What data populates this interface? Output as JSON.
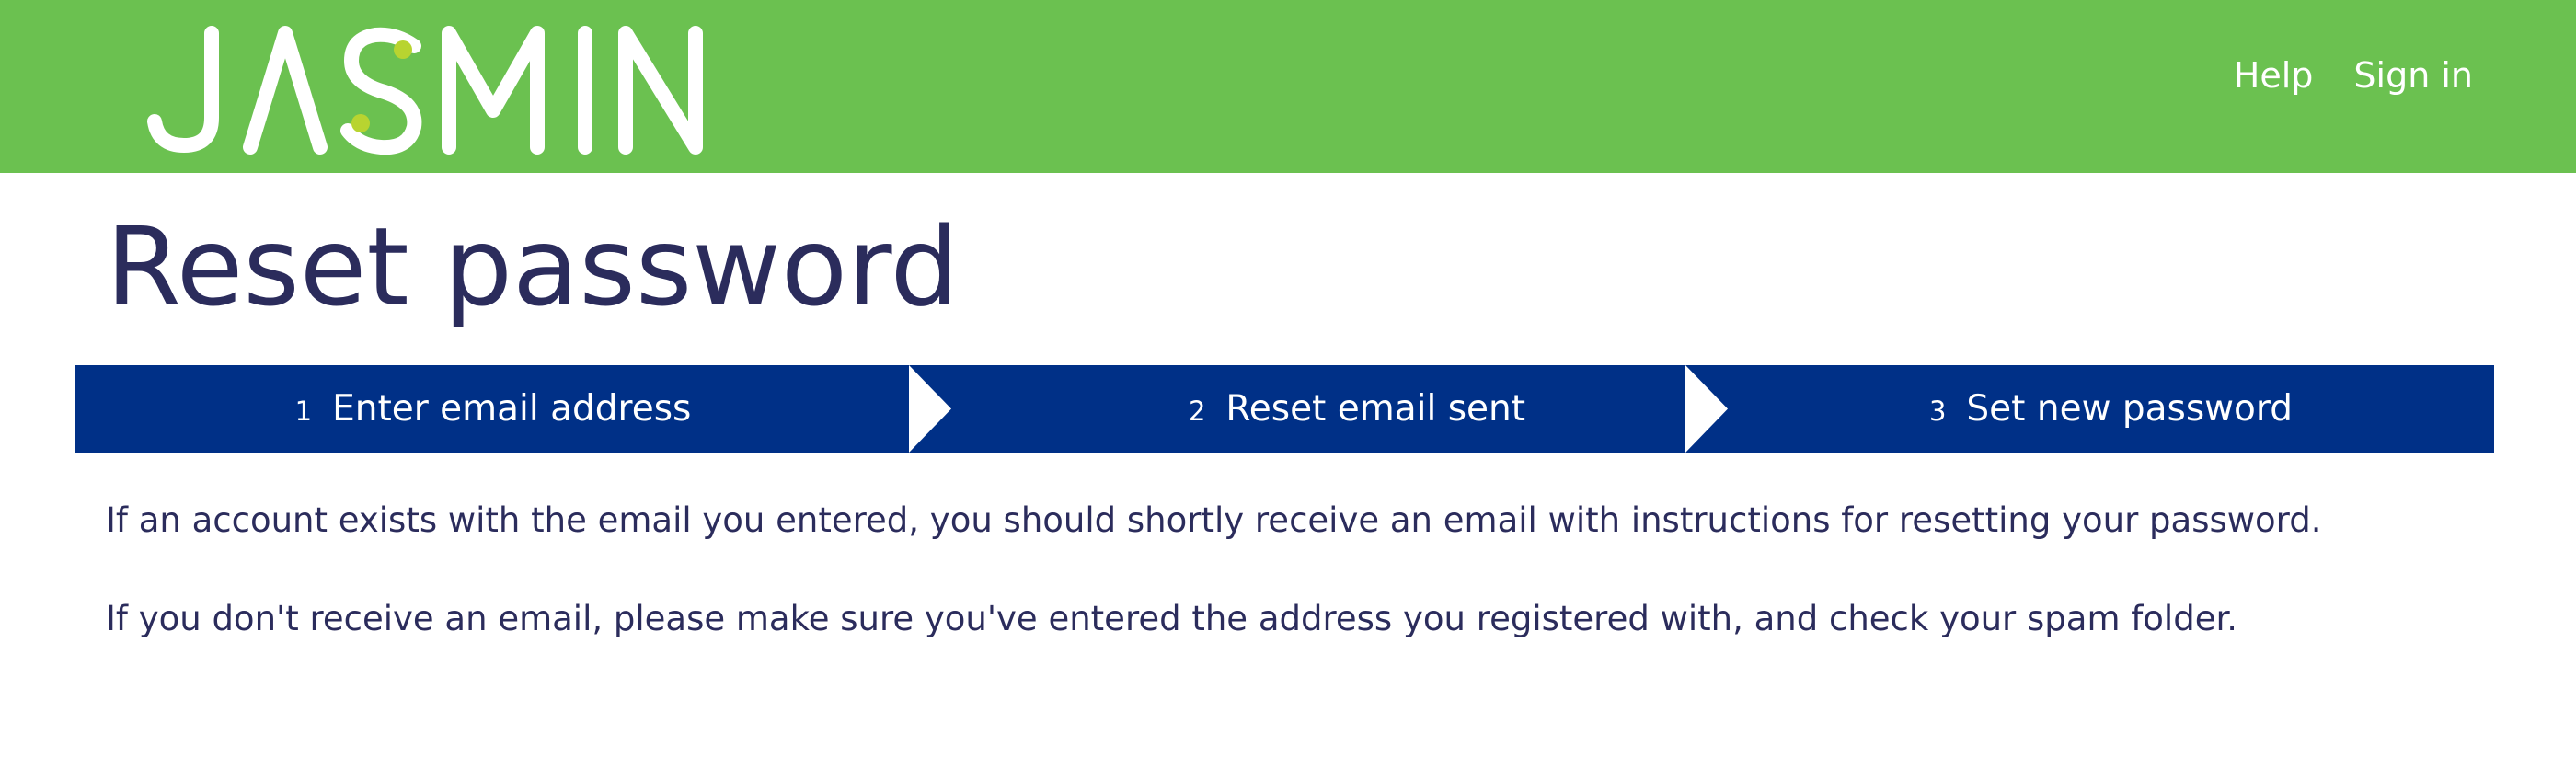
{
  "brand": {
    "logo_text": "JASMIN",
    "header_color": "#6bc150",
    "logo_dot_color": "#b8d430"
  },
  "nav": {
    "help_label": "Help",
    "signin_label": "Sign in"
  },
  "page": {
    "title": "Reset password"
  },
  "steps": [
    {
      "number": "1",
      "label": "Enter email address"
    },
    {
      "number": "2",
      "label": "Reset email sent"
    },
    {
      "number": "3",
      "label": "Set new password"
    }
  ],
  "steps_bar_color": "#003087",
  "messages": [
    "If an account exists with the email you entered, you should shortly receive an email with instructions for resetting your password.",
    "If you don't receive an email, please make sure you've entered the address you registered with, and check your spam folder."
  ]
}
